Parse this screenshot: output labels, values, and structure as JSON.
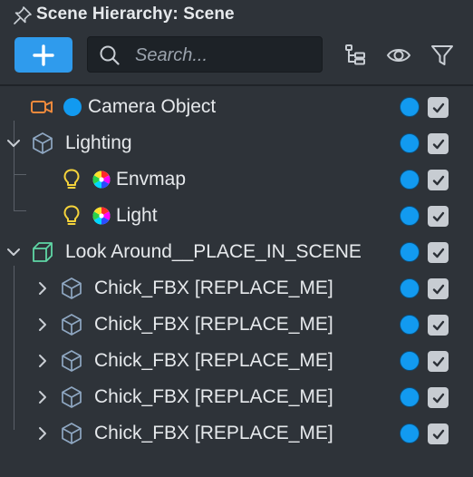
{
  "panel": {
    "title": "Scene Hierarchy: Scene"
  },
  "toolbar": {
    "add_icon": "plus-icon",
    "search_placeholder": "Search...",
    "search_value": "",
    "icons": [
      "hierarchy-icon",
      "eye-icon",
      "filter-icon"
    ]
  },
  "colors": {
    "accent": "#2f9bed",
    "visibility_dot": "#129af0",
    "camera_icon": "#f08a3c",
    "light_icon": "#f5d33b",
    "look_around_icon": "#5fd6a5",
    "object_icon": "#8fa7c2"
  },
  "tree": [
    {
      "label": "Camera Object",
      "icon": "camera-icon",
      "expanded": null,
      "depth": 0,
      "visible": true,
      "enabled": true
    },
    {
      "label": "Lighting",
      "icon": "box-icon",
      "expanded": true,
      "depth": 0,
      "visible": true,
      "enabled": true
    },
    {
      "label": "Envmap",
      "icon": "lightbulb-icon",
      "expanded": null,
      "depth": 1,
      "visible": true,
      "enabled": true
    },
    {
      "label": "Light",
      "icon": "lightbulb-icon",
      "expanded": null,
      "depth": 1,
      "visible": true,
      "enabled": true
    },
    {
      "label": "Look Around__PLACE_IN_SCENE",
      "icon": "box-icon",
      "expanded": true,
      "depth": 0,
      "visible": true,
      "enabled": true
    },
    {
      "label": "Chick_FBX [REPLACE_ME]",
      "icon": "box-icon",
      "expanded": false,
      "depth": 1,
      "visible": true,
      "enabled": true
    },
    {
      "label": "Chick_FBX [REPLACE_ME]",
      "icon": "box-icon",
      "expanded": false,
      "depth": 1,
      "visible": true,
      "enabled": true
    },
    {
      "label": "Chick_FBX [REPLACE_ME]",
      "icon": "box-icon",
      "expanded": false,
      "depth": 1,
      "visible": true,
      "enabled": true
    },
    {
      "label": "Chick_FBX [REPLACE_ME]",
      "icon": "box-icon",
      "expanded": false,
      "depth": 1,
      "visible": true,
      "enabled": true
    },
    {
      "label": "Chick_FBX [REPLACE_ME]",
      "icon": "box-icon",
      "expanded": false,
      "depth": 1,
      "visible": true,
      "enabled": true
    }
  ]
}
